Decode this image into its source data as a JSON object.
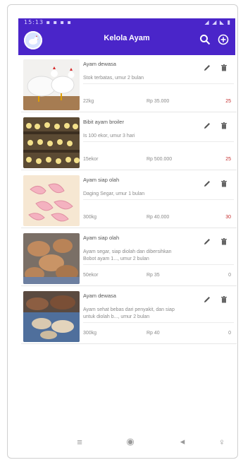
{
  "statusbar": {
    "time": "15:13",
    "icons": "▪ ▪ ▪ ▪",
    "right": "◢ ◢ ◣ ▮"
  },
  "appbar": {
    "title": "Kelola Ayam"
  },
  "products": [
    {
      "name": "Ayam dewasa",
      "desc_line1": "Stok terbatas, umur 2 bulan",
      "desc_line2": "",
      "qty": "22kg",
      "price": "Rp 35.000",
      "stock": "25"
    },
    {
      "name": "Bibit ayam broiler",
      "desc_line1": "Is 100 ekor, umur 3 hari",
      "desc_line2": "",
      "qty": "15ekor",
      "price": "Rp 500.000",
      "stock": "25"
    },
    {
      "name": "Ayam siap olah",
      "desc_line1": "Daging Segar, umur 1 bulan",
      "desc_line2": "",
      "qty": "300kg",
      "price": "Rp 40.000",
      "stock": "30"
    },
    {
      "name": "Ayam siap olah",
      "desc_line1": "Ayam segar, siap diolah dan dibersihkan",
      "desc_line2": "Bobot ayam 1..., umur 2 bulan",
      "qty": "50ekor",
      "price": "Rp 35",
      "stock": "0"
    },
    {
      "name": "Ayam dewasa",
      "desc_line1": "Ayam sehat bebas dari penyakit, dan siap",
      "desc_line2": "untuk diolah b..., umur 2 bulan",
      "qty": "300kg",
      "price": "Rp 40",
      "stock": "0"
    }
  ],
  "navbar": {
    "menu_icon": "≡",
    "home_icon": "◉",
    "back_icon": "◂",
    "accessibility_icon": "♀"
  },
  "colors": {
    "appbar": "#4a25c9",
    "stock_red": "#c53030"
  }
}
